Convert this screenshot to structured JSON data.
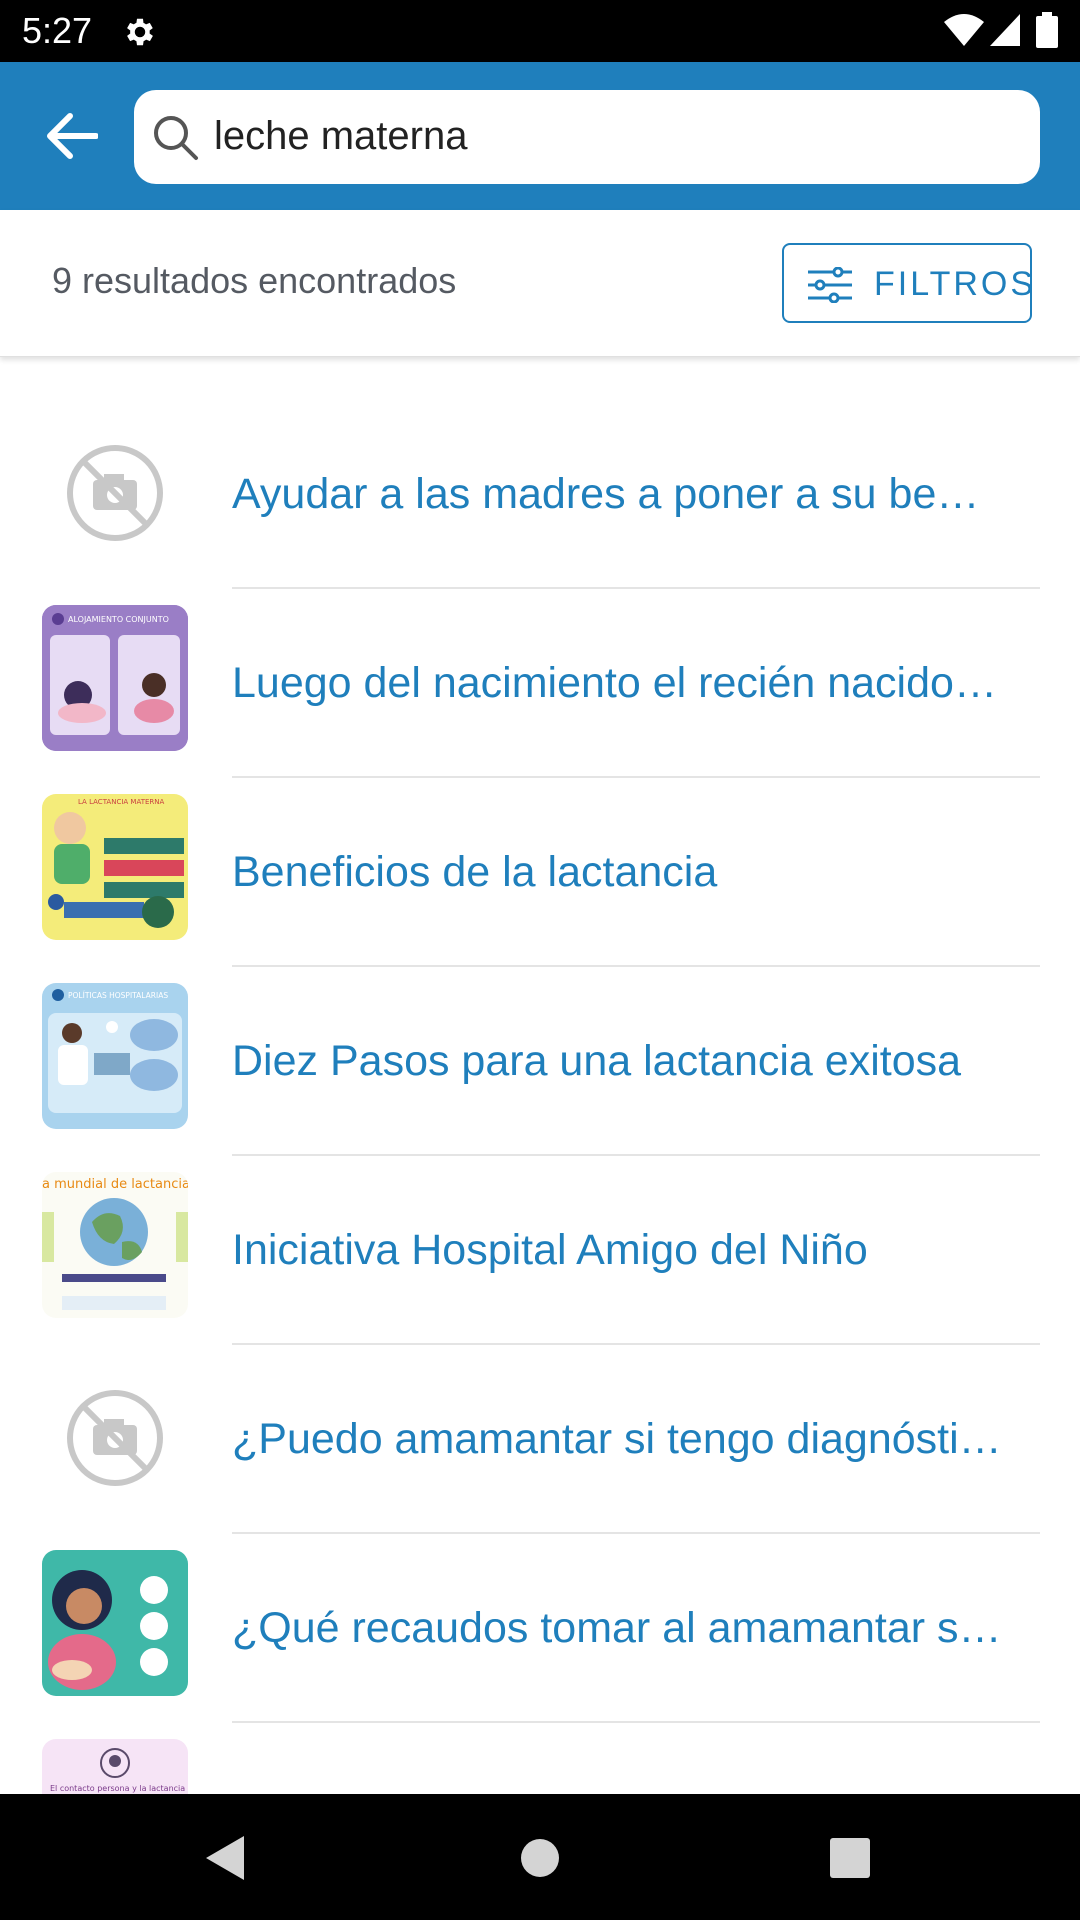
{
  "status_bar": {
    "time": "5:27",
    "icons": [
      "gear-icon",
      "wifi-icon",
      "signal-icon",
      "battery-icon"
    ]
  },
  "app_bar": {
    "back_icon": "arrow-left-icon",
    "search": {
      "icon": "search-icon",
      "value": "leche materna"
    },
    "color": "#1f7fbc"
  },
  "results": {
    "count_text": "9 resultados encontrados",
    "filter_label": "FILTROS",
    "filter_icon": "sliders-icon"
  },
  "items": [
    {
      "title": "Ayudar a las madres a poner a su bebé …",
      "thumbnail": "no-image-icon"
    },
    {
      "title": "Luego del nacimiento el recién nacido d…",
      "thumbnail": "alojamiento-conjunto"
    },
    {
      "title": "Beneficios de la lactancia",
      "thumbnail": "la-lactancia-materna"
    },
    {
      "title": "Diez Pasos para una lactancia exitosa",
      "thumbnail": "politicas-hospitalarias"
    },
    {
      "title": "Iniciativa Hospital Amigo del Niño",
      "thumbnail": "semana-mundial-lactancia"
    },
    {
      "title": "¿Puedo amamantar si tengo diagnóstic…",
      "thumbnail": "no-image-icon"
    },
    {
      "title": "¿Qué recaudos tomar al amamantar si t…",
      "thumbnail": "amamantar-infografia"
    },
    {
      "title": "",
      "thumbnail": "contacto-persona-lactancia"
    }
  ],
  "thumbnail_texts": {
    "alojamiento": "ALOJAMIENTO CONJUNTO",
    "lactancia": "LA LACTANCIA MATERNA",
    "politicas": "POLÍTICAS HOSPITALARIAS",
    "semana": "a mundial de lactancia m",
    "contacto": "El contacto persona y la lactancia"
  },
  "nav_bar": {
    "icons": [
      "back-triangle-icon",
      "home-circle-icon",
      "recents-square-icon"
    ]
  }
}
